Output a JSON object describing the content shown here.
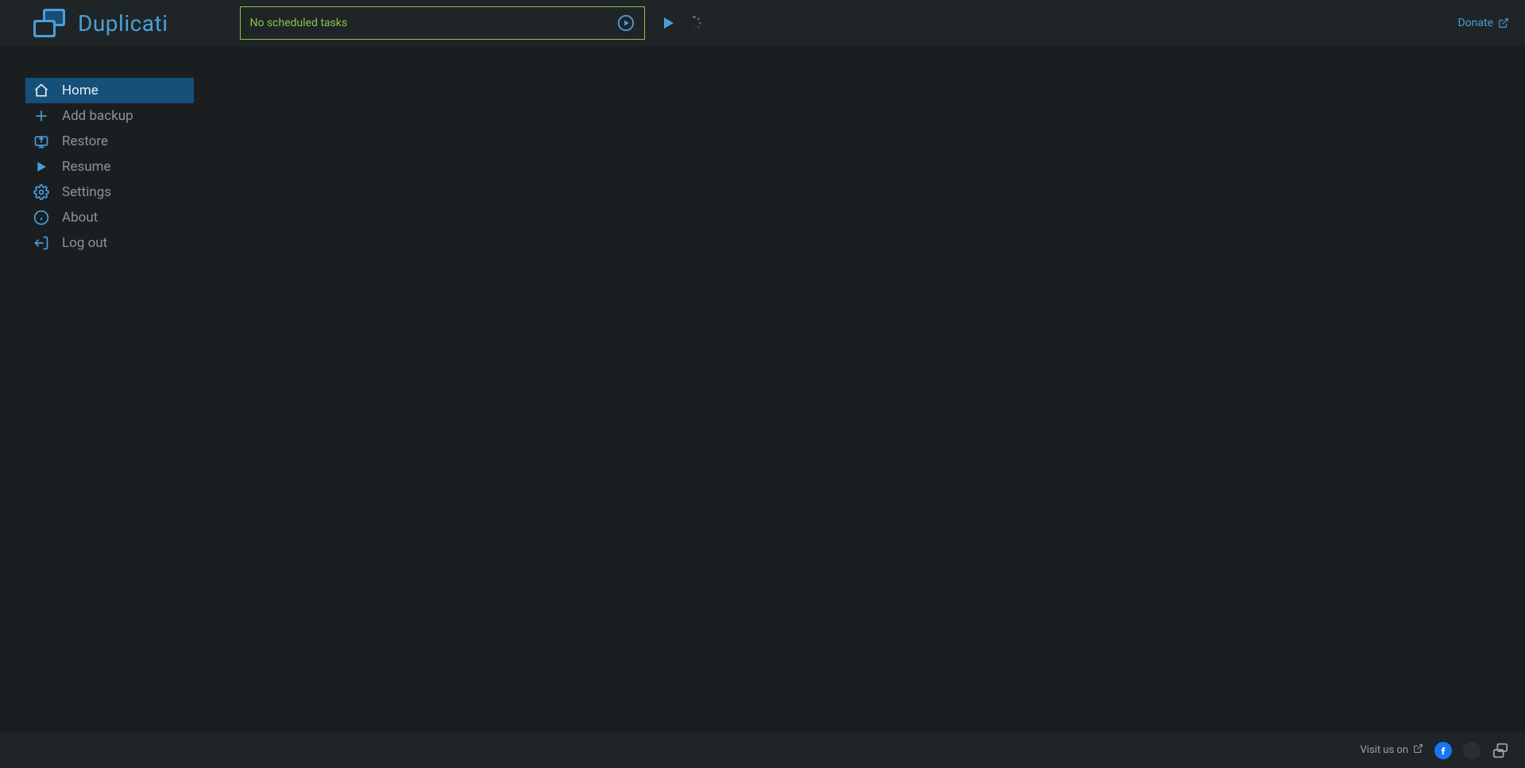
{
  "header": {
    "app_title": "Duplicati",
    "status_text": "No scheduled tasks",
    "donate_label": "Donate"
  },
  "sidebar": {
    "items": [
      {
        "label": "Home",
        "icon": "home-icon",
        "active": true
      },
      {
        "label": "Add backup",
        "icon": "plus-icon",
        "active": false
      },
      {
        "label": "Restore",
        "icon": "restore-icon",
        "active": false
      },
      {
        "label": "Resume",
        "icon": "play-icon",
        "active": false
      },
      {
        "label": "Settings",
        "icon": "gear-icon",
        "active": false
      },
      {
        "label": "About",
        "icon": "info-icon",
        "active": false
      },
      {
        "label": "Log out",
        "icon": "logout-icon",
        "active": false
      }
    ]
  },
  "footer": {
    "visit_label": "Visit us on"
  },
  "colors": {
    "accent": "#4a9fd8",
    "status_border": "#8BC34A",
    "sidebar_active_bg": "#15507b",
    "header_bg": "#1f2427",
    "body_bg": "#1a1e21"
  }
}
